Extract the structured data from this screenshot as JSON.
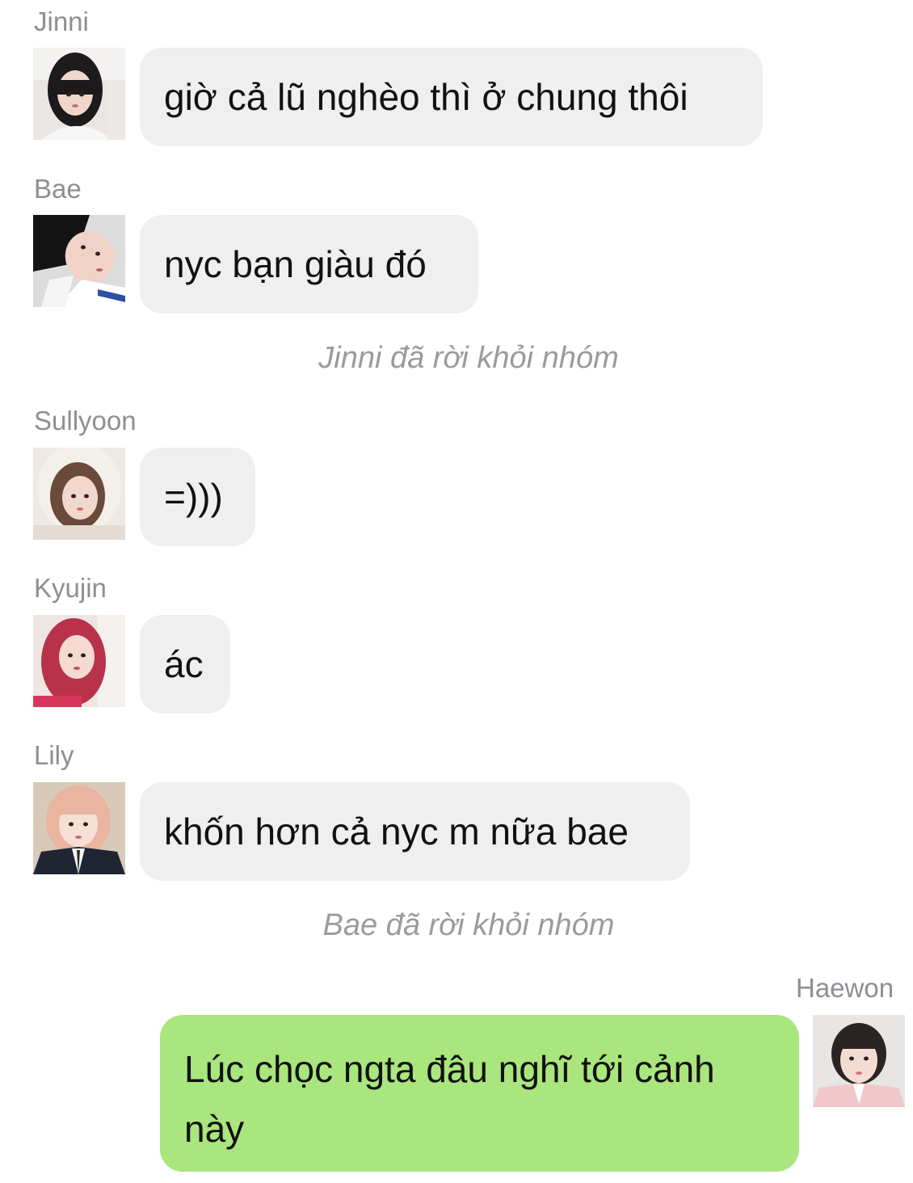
{
  "messages": [
    {
      "sender": "Jinni",
      "text": "giờ cả lũ nghèo thì ở chung thôi"
    },
    {
      "sender": "Bae",
      "text": "nyc bạn giàu đó"
    },
    {
      "sender": "Sullyoon",
      "text": "=)))"
    },
    {
      "sender": "Kyujin",
      "text": "ác"
    },
    {
      "sender": "Lily",
      "text": "khốn hơn cả nyc m nữa bae"
    }
  ],
  "system_notes": [
    "Jinni đã rời khỏi nhóm",
    "Bae đã rời khỏi nhóm"
  ],
  "outgoing": {
    "sender": "Haewon",
    "text": "Lúc chọc ngta đâu nghĩ tới cảnh này"
  },
  "colors": {
    "incoming_bubble": "#efefef",
    "outgoing_bubble": "#a9e67e",
    "name_text": "#8e8e93",
    "system_text": "#9b9b9f"
  }
}
